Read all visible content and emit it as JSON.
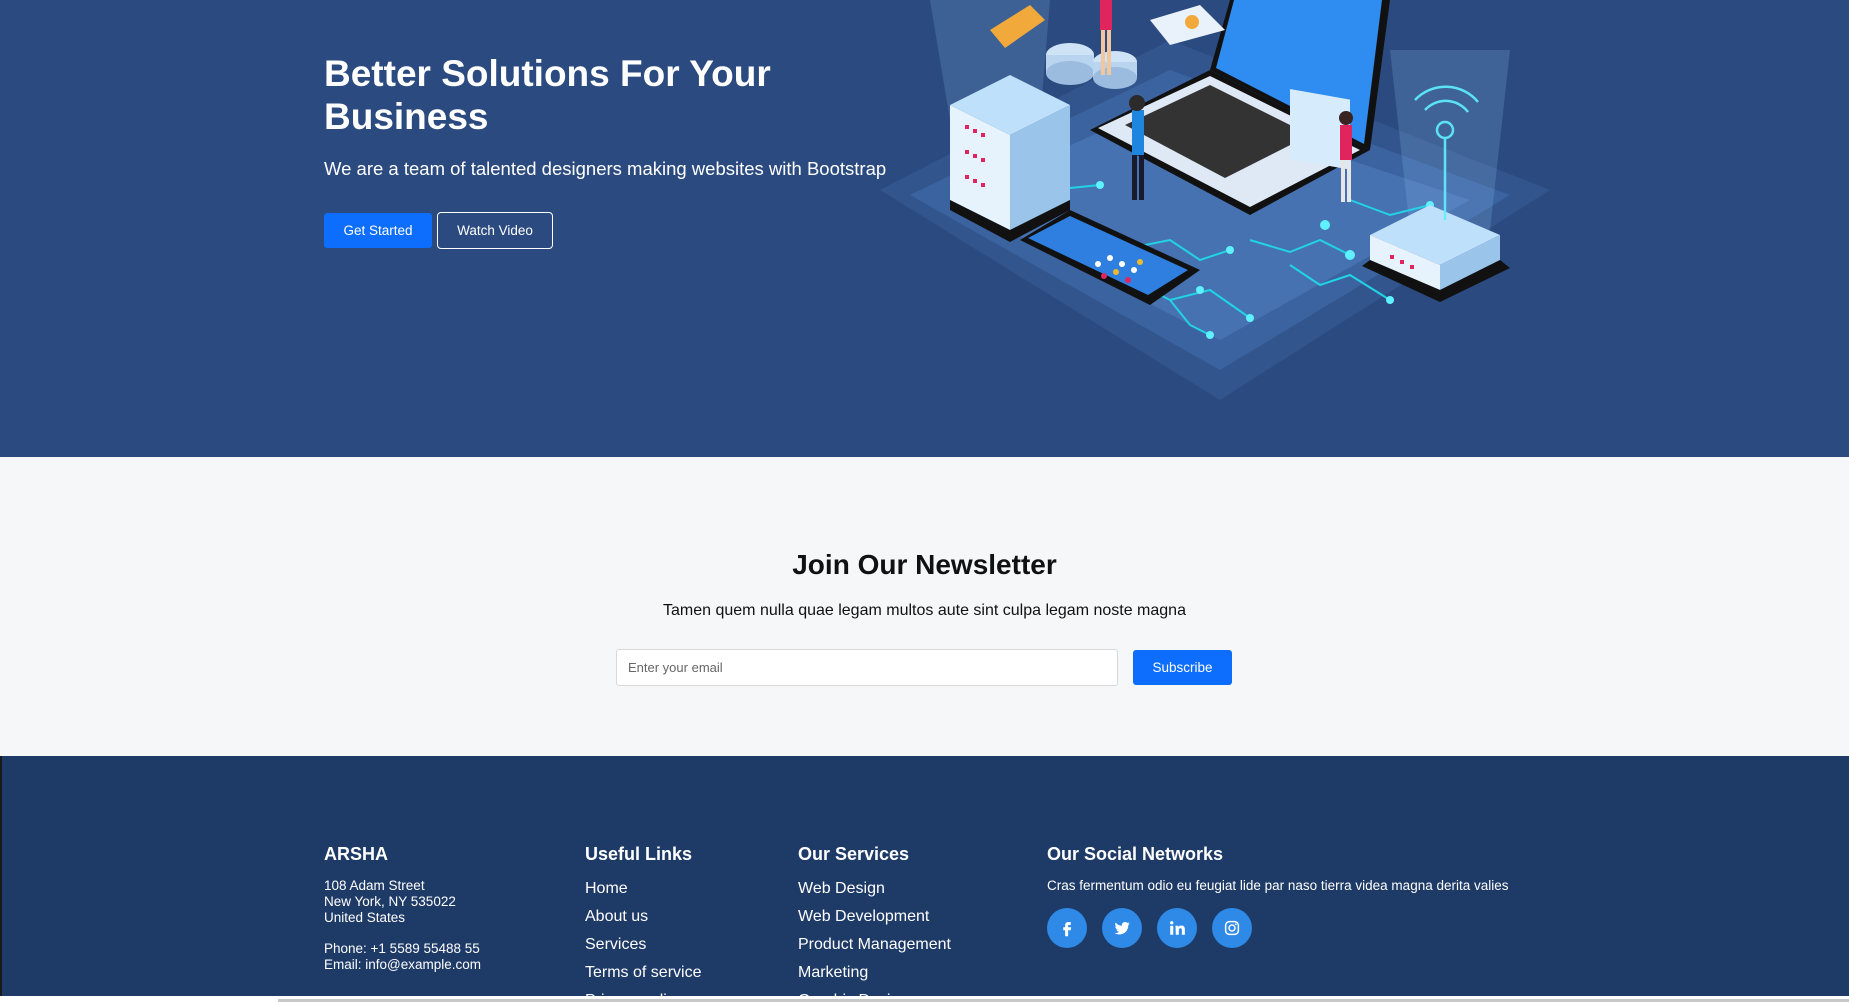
{
  "hero": {
    "title": "Better Solutions For Your Business",
    "subtitle": "We are a team of talented designers making websites with Bootstrap",
    "primary_button": "Get Started",
    "secondary_button": "Watch Video"
  },
  "newsletter": {
    "title": "Join Our Newsletter",
    "subtitle": "Tamen quem nulla quae legam multos aute sint culpa legam noste magna",
    "email_placeholder": "Enter your email",
    "subscribe_button": "Subscribe"
  },
  "footer": {
    "brand": "ARSHA",
    "address_line1": "108 Adam Street",
    "address_line2": "New York, NY 535022",
    "address_line3": "United States",
    "phone": "Phone: +1 5589 55488 55",
    "email": "Email: info@example.com",
    "useful_links": {
      "heading": "Useful Links",
      "items": [
        "Home",
        "About us",
        "Services",
        "Terms of service",
        "Privacy policy"
      ]
    },
    "services": {
      "heading": "Our Services",
      "items": [
        "Web Design",
        "Web Development",
        "Product Management",
        "Marketing",
        "Graphic Design"
      ]
    },
    "social": {
      "heading": "Our Social Networks",
      "text": "Cras fermentum odio eu feugiat lide par naso tierra videa magna derita valies",
      "icons": [
        "facebook-icon",
        "twitter-icon",
        "linkedin-icon",
        "instagram-icon"
      ]
    }
  },
  "colors": {
    "hero_bg": "#2b4b80",
    "footer_bg": "#1e3a66",
    "accent": "#0d6efd",
    "social_bg": "#2e8ae6",
    "newsletter_bg": "#f6f7f9"
  }
}
